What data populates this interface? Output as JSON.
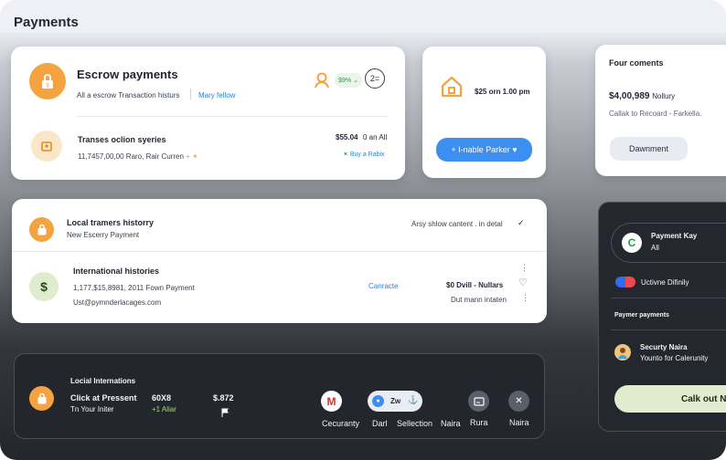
{
  "header": {
    "title": "Payments"
  },
  "escrow": {
    "title": "Escrow payments",
    "subtitle": "All a escrow Transaction histurs",
    "link": "Mary fellow",
    "badge": "$9% ⌄",
    "counter": "2=",
    "row_title": "Transes oclion syeries",
    "row_sub": "11,7457,00,00 Raro, Rair Curren",
    "row_amount": "$55.04",
    "row_amount_note": "0 an All",
    "row_action": "Buy a Rabix"
  },
  "schedule": {
    "time": "$25 orn 1.00 pm",
    "button": "+ I-nable Parker ♥"
  },
  "comments": {
    "title": "Four coments",
    "amount": "$4,00,989",
    "amount_suffix": "Nollury",
    "note": "Callak to Recoard - Farkella.",
    "button": "Dawnment"
  },
  "history": {
    "title": "Local tramers historry",
    "subtitle": "New Escerry Payment",
    "right_note": "Arsy shlow cantent . in detal",
    "row_title": "International histories",
    "row_sub1": "1,177,$15,8981, 2011 Fown Payment",
    "row_sub2": "Ust@pymnderlacages.com",
    "row_link": "Canracte",
    "row_amount": "$0 Dvill - Nullars",
    "row_note": "Dut mann intaten"
  },
  "side": {
    "payment_key": "Payment Kay",
    "payment_key_sub": "All",
    "toggle_label": "Uctivne Difinily",
    "section": "Paymer payments",
    "user_name": "Securty Naira",
    "user_sub": "Younto for Calerunity",
    "button": "Calk out Ne"
  },
  "bottom": {
    "title": "Locial Internations",
    "line1": "Click at Pressent",
    "line2": "Tn Your Initer",
    "stat1": "60X8",
    "stat1_sub": "+1 Aliar",
    "stat2": "$.872",
    "apps": [
      {
        "label": "Cecuranty",
        "icon": "gmail-icon"
      },
      {
        "label": "Darl",
        "icon": "shield-icon"
      },
      {
        "label": "Sellection",
        "icon": "zw-icon"
      },
      {
        "label": "Naira",
        "icon": ""
      },
      {
        "label": "Rura",
        "icon": "screen-icon"
      },
      {
        "label": "Naira",
        "icon": "tools-icon"
      }
    ],
    "pill_text": "Zw"
  },
  "colors": {
    "orange": "#f4a340",
    "blue": "#3c8ef0",
    "green": "#2a9d4b",
    "mint": "#dfeccd"
  }
}
